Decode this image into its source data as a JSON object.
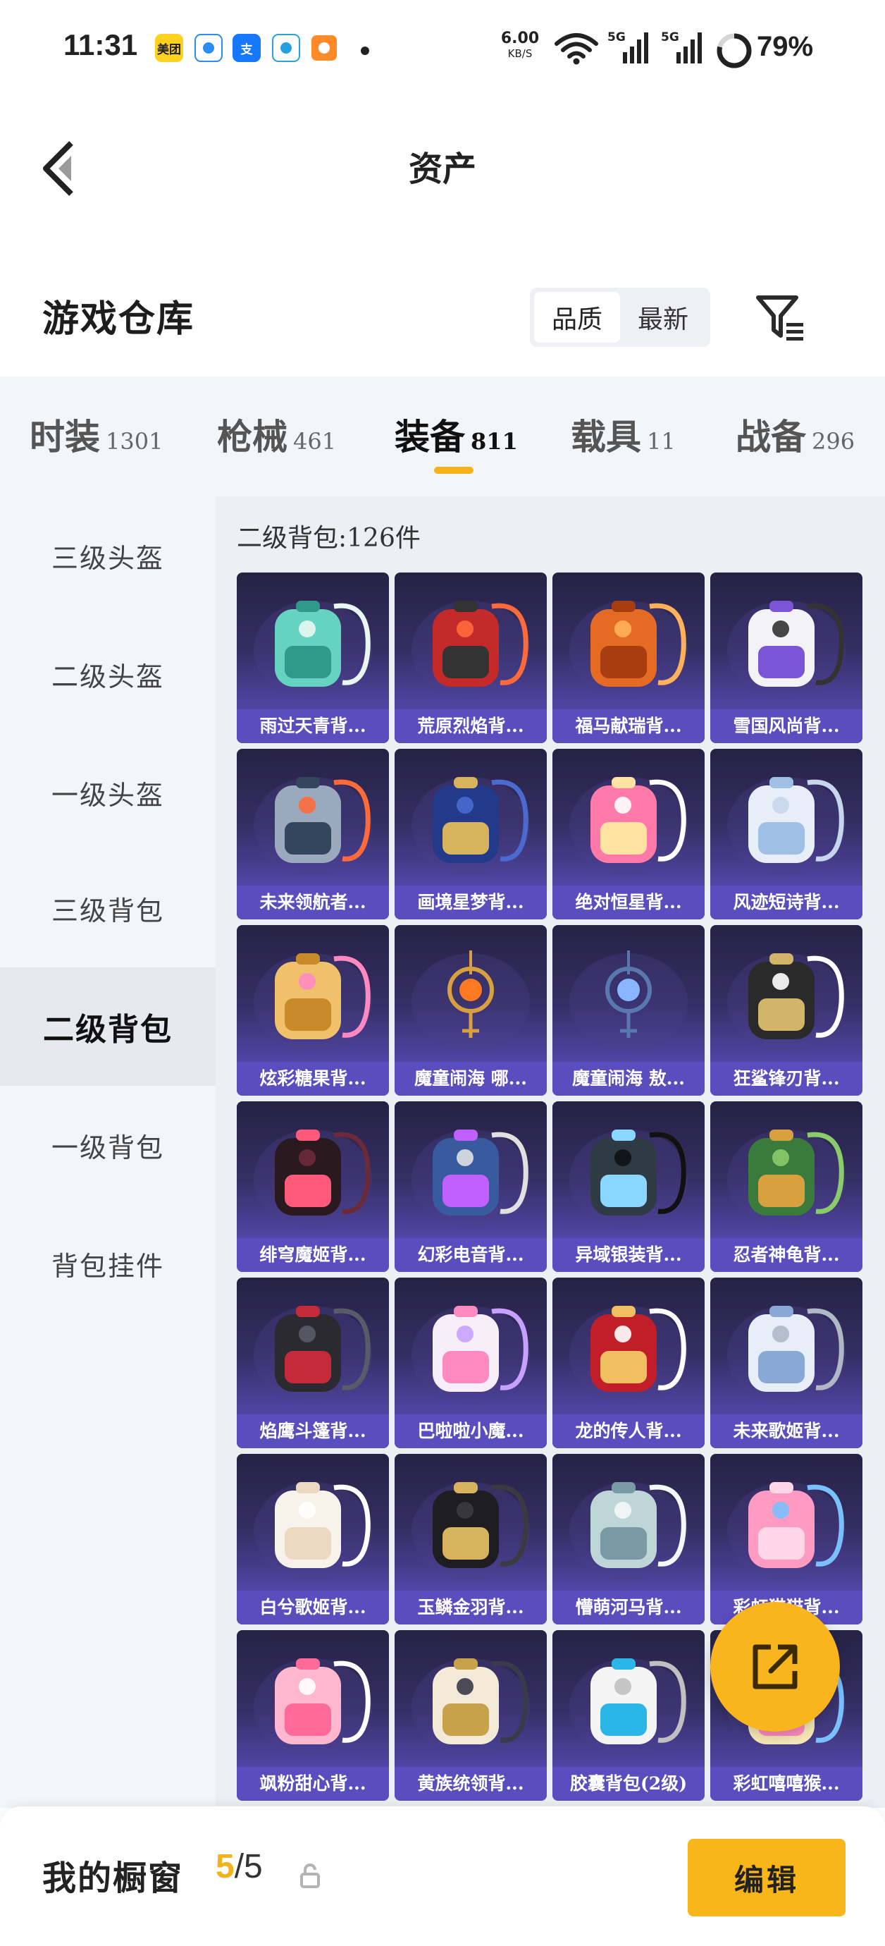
{
  "status_bar": {
    "time": "11:31",
    "app_icons": [
      {
        "name": "meituan-app-icon",
        "text": "美团",
        "bg": "#ffd21f",
        "fg": "#222222"
      },
      {
        "name": "browser-app-icon",
        "text": "",
        "bg": "#ffffff",
        "fg": "#2a8cf5"
      },
      {
        "name": "alipay-app-icon",
        "text": "支",
        "bg": "#1677ff",
        "fg": "#ffffff"
      },
      {
        "name": "paper-plane-app-icon",
        "text": "",
        "bg": "#ffffff",
        "fg": "#24a1de"
      },
      {
        "name": "video-app-icon",
        "text": "",
        "bg": "#ff8a2a",
        "fg": "#ffffff"
      }
    ],
    "net_speed_value": "6.00",
    "net_speed_unit": "KB/S",
    "signal_1": "5G",
    "signal_2": "5G",
    "battery": "79%",
    "battery_level": 0.79
  },
  "header": {
    "title": "资产"
  },
  "warehouse": {
    "title": "游戏仓库",
    "sort_options": [
      "品质",
      "最新"
    ],
    "sort_active": "品质"
  },
  "category_tabs": [
    {
      "name": "时装",
      "count": "1301"
    },
    {
      "name": "枪械",
      "count": "461"
    },
    {
      "name": "装备",
      "count": "811"
    },
    {
      "name": "载具",
      "count": "11"
    },
    {
      "name": "战备",
      "count": "296"
    }
  ],
  "category_active": "装备",
  "sidebar": {
    "items": [
      "三级头盔",
      "二级头盔",
      "一级头盔",
      "三级背包",
      "二级背包",
      "一级背包",
      "背包挂件"
    ],
    "active": "二级背包"
  },
  "content": {
    "heading": "二级背包:126件",
    "items": [
      {
        "label": "雨过天青背...",
        "icon": "teal-dragon-backpack"
      },
      {
        "label": "荒原烈焰背...",
        "icon": "red-armor-backpack"
      },
      {
        "label": "福马献瑞背...",
        "icon": "orange-horse-backpack"
      },
      {
        "label": "雪国风尚背...",
        "icon": "snowman-backpack"
      },
      {
        "label": "未来领航者...",
        "icon": "tech-frame-backpack"
      },
      {
        "label": "画境星梦背...",
        "icon": "blue-book-backpack"
      },
      {
        "label": "绝对恒星背...",
        "icon": "popcorn-backpack"
      },
      {
        "label": "风迹短诗背...",
        "icon": "white-box-backpack"
      },
      {
        "label": "炫彩糖果背...",
        "icon": "candy-round-backpack"
      },
      {
        "label": "魔童闹海 哪...",
        "icon": "fire-orb-pendant"
      },
      {
        "label": "魔童闹海 敖...",
        "icon": "water-orb-pendant"
      },
      {
        "label": "狂鲨锋刃背...",
        "icon": "shark-backpack"
      },
      {
        "label": "绯穹魔姬背...",
        "icon": "bat-backpack"
      },
      {
        "label": "幻彩电音背...",
        "icon": "speaker-eye-backpack"
      },
      {
        "label": "异域银装背...",
        "icon": "dark-tech-backpack"
      },
      {
        "label": "忍者神龟背...",
        "icon": "turtle-backpack"
      },
      {
        "label": "焰鹰斗篷背...",
        "icon": "hawk-backpack"
      },
      {
        "label": "巴啦啦小魔...",
        "icon": "magic-fairy-backpack"
      },
      {
        "label": "龙的传人背...",
        "icon": "red-dragon-backpack"
      },
      {
        "label": "未来歌姬背...",
        "icon": "silver-idol-backpack"
      },
      {
        "label": "白兮歌姬背...",
        "icon": "bunny-backpack"
      },
      {
        "label": "玉鳞金羽背...",
        "icon": "black-gold-bag"
      },
      {
        "label": "懵萌河马背...",
        "icon": "hippo-backpack"
      },
      {
        "label": "彩虹猫猫背...",
        "icon": "pink-cat-backpack"
      },
      {
        "label": "飒粉甜心背...",
        "icon": "pink-heart-backpack"
      },
      {
        "label": "黄族统领背...",
        "icon": "gold-armor-backpack"
      },
      {
        "label": "胶囊背包(2级)",
        "icon": "capsule-backpack"
      },
      {
        "label": "彩虹嘻嘻猴...",
        "icon": "monkey-backpack"
      }
    ]
  },
  "bottom_bar": {
    "label": "我的橱窗",
    "count_current": "5",
    "count_total": "/5",
    "edit_label": "编辑"
  },
  "colors": {
    "accent_yellow": "#f5b21a",
    "card_purple": "#5a4dbd",
    "panel_bg": "#f3f6f9"
  }
}
